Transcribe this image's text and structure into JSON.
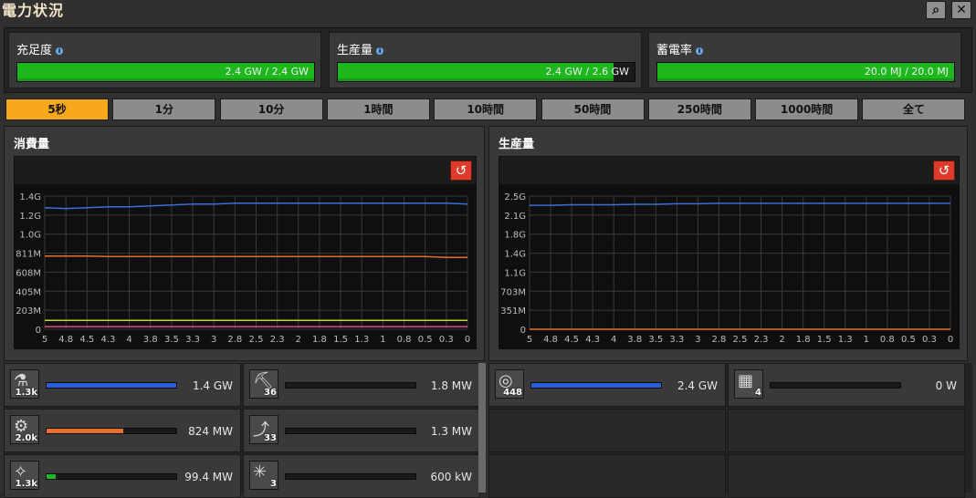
{
  "window": {
    "title": "電力状況"
  },
  "header_buttons": [
    {
      "name": "search-button",
      "glyph": "⌕"
    },
    {
      "name": "close-button",
      "glyph": "✕"
    }
  ],
  "stats": [
    {
      "label": "充足度",
      "value": "2.4 GW / 2.4 GW",
      "fill": 1.0
    },
    {
      "label": "生産量",
      "value": "2.4 GW / 2.6 GW",
      "fill": 0.93
    },
    {
      "label": "蓄電率",
      "value": "20.0 MJ / 20.0 MJ",
      "fill": 1.0
    }
  ],
  "tabs": [
    "5秒",
    "1分",
    "10分",
    "1時間",
    "10時間",
    "50時間",
    "250時間",
    "1000時間",
    "全て"
  ],
  "active_tab": 0,
  "consumption_panel": {
    "title": "消費量",
    "reset_icon": "↺",
    "chart_data": {
      "type": "line",
      "y_ticks": [
        "1.4G",
        "1.2G",
        "1.0G",
        "811M",
        "608M",
        "405M",
        "203M",
        "0"
      ],
      "x_ticks": [
        "5",
        "4.8",
        "4.5",
        "4.3",
        "4",
        "3.8",
        "3.5",
        "3.3",
        "3",
        "2.8",
        "2.5",
        "2.3",
        "2",
        "1.8",
        "1.5",
        "1.3",
        "1",
        "0.8",
        "0.5",
        "0.3",
        "0"
      ],
      "ymax": 1.5,
      "series": [
        {
          "color": "#3d6fd8",
          "values": [
            1.37,
            1.36,
            1.37,
            1.38,
            1.38,
            1.39,
            1.4,
            1.41,
            1.41,
            1.42,
            1.42,
            1.42,
            1.42,
            1.42,
            1.42,
            1.42,
            1.42,
            1.42,
            1.42,
            1.42,
            1.41
          ]
        },
        {
          "color": "#e8702a",
          "values": [
            0.824,
            0.824,
            0.824,
            0.82,
            0.82,
            0.82,
            0.82,
            0.82,
            0.82,
            0.82,
            0.82,
            0.82,
            0.82,
            0.82,
            0.82,
            0.82,
            0.82,
            0.82,
            0.82,
            0.81,
            0.81
          ]
        },
        {
          "color": "#b8d84a",
          "values": [
            0.1,
            0.1,
            0.1,
            0.1,
            0.1,
            0.1,
            0.1,
            0.1,
            0.1,
            0.1,
            0.1,
            0.1,
            0.1,
            0.1,
            0.1,
            0.1,
            0.1,
            0.1,
            0.1,
            0.1,
            0.1
          ]
        },
        {
          "color": "#e04a8a",
          "values": [
            0.03,
            0.03,
            0.03,
            0.03,
            0.03,
            0.03,
            0.03,
            0.03,
            0.03,
            0.03,
            0.03,
            0.03,
            0.03,
            0.03,
            0.03,
            0.03,
            0.03,
            0.03,
            0.03,
            0.03,
            0.03
          ]
        }
      ]
    }
  },
  "production_panel": {
    "title": "生産量",
    "reset_icon": "↺",
    "chart_data": {
      "type": "line",
      "y_ticks": [
        "2.5G",
        "2.1G",
        "1.8G",
        "1.4G",
        "1.1G",
        "703M",
        "351M",
        "0"
      ],
      "x_ticks": [
        "5",
        "4.8",
        "4.5",
        "4.3",
        "4",
        "3.8",
        "3.5",
        "3.3",
        "3",
        "2.8",
        "2.5",
        "2.3",
        "2",
        "1.8",
        "1.5",
        "1.3",
        "1",
        "0.8",
        "0.5",
        "0.3",
        "0"
      ],
      "ymax": 2.6,
      "series": [
        {
          "color": "#3d6fd8",
          "values": [
            2.42,
            2.42,
            2.43,
            2.43,
            2.43,
            2.44,
            2.44,
            2.45,
            2.45,
            2.46,
            2.46,
            2.46,
            2.46,
            2.46,
            2.46,
            2.46,
            2.46,
            2.46,
            2.46,
            2.46,
            2.46
          ]
        },
        {
          "color": "#e8702a",
          "values": [
            0.0,
            0.0,
            0.0,
            0.0,
            0.0,
            0.0,
            0.0,
            0.0,
            0.0,
            0.0,
            0.0,
            0.0,
            0.0,
            0.0,
            0.0,
            0.0,
            0.0,
            0.0,
            0.0,
            0.0,
            0.0
          ]
        }
      ]
    }
  },
  "consumers": [
    {
      "icon": "lab-icon",
      "glyph": "⚗",
      "count": "1.3k",
      "value": "1.4 GW",
      "fill": 1.0,
      "color": "#2a5fd8"
    },
    {
      "icon": "drill-icon",
      "glyph": "⛏",
      "count": "36",
      "value": "1.8 MW",
      "fill": 0.0,
      "color": "#2a5fd8"
    },
    {
      "icon": "assembler-icon",
      "glyph": "⚙",
      "count": "2.0k",
      "value": "824 MW",
      "fill": 0.59,
      "color": "#e8702a"
    },
    {
      "icon": "inserter-icon",
      "glyph": "⤴",
      "count": "33",
      "value": "1.3 MW",
      "fill": 0.0,
      "color": "#2a5fd8"
    },
    {
      "icon": "beacon-icon",
      "glyph": "✧",
      "count": "1.3k",
      "value": "99.4 MW",
      "fill": 0.07,
      "color": "#1eb81e"
    },
    {
      "icon": "radar-icon",
      "glyph": "✳",
      "count": "3",
      "value": "600 kW",
      "fill": 0.0,
      "color": "#2a5fd8"
    }
  ],
  "producers": [
    {
      "icon": "reactor-icon",
      "glyph": "◎",
      "count": "448",
      "value": "2.4 GW",
      "fill": 1.0,
      "color": "#2a5fd8"
    },
    {
      "icon": "accumulator-icon",
      "glyph": "▦",
      "count": "4",
      "value": "0 W",
      "fill": 0.0,
      "color": "#2a5fd8"
    }
  ]
}
